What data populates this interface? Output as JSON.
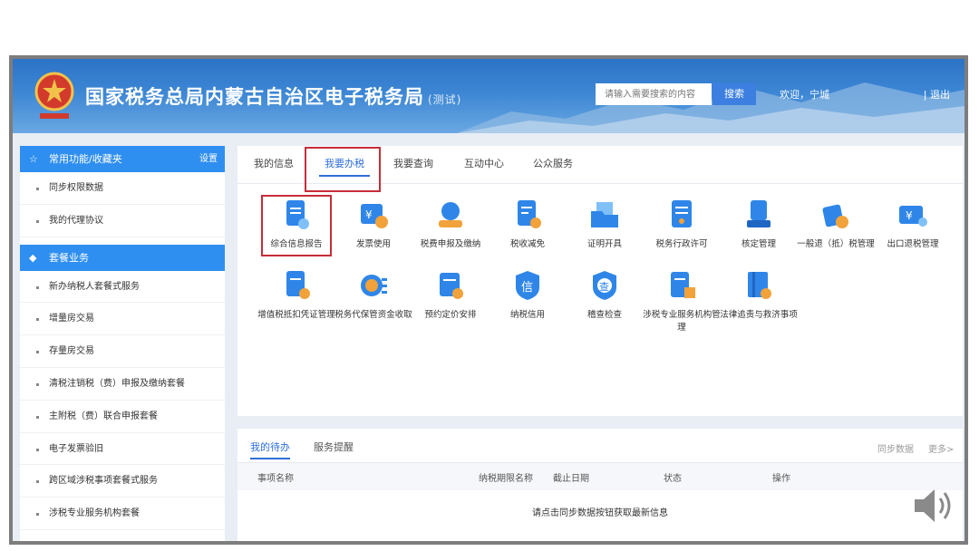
{
  "header": {
    "title": "国家税务总局内蒙古自治区电子税务局",
    "title_suffix": "(测试)",
    "search_placeholder": "请输入需要搜索的内容",
    "search_button": "搜索",
    "welcome": "欢迎，宁城",
    "logout": "| 退出"
  },
  "sidebar": {
    "section1": {
      "title": "常用功能/收藏夹",
      "action": "设置"
    },
    "section1_items": [
      "同步权限数据",
      "我的代理协议"
    ],
    "section2": {
      "title": "套餐业务"
    },
    "section2_items": [
      "新办纳税人套餐式服务",
      "增量房交易",
      "存量房交易",
      "清税注销税（费）申报及缴纳套餐",
      "主附税（费）联合申报套餐",
      "电子发票验旧",
      "跨区域涉税事项套餐式服务",
      "涉税专业服务机构套餐"
    ]
  },
  "tabs": [
    "我的信息",
    "我要办税",
    "我要查询",
    "互动中心",
    "公众服务"
  ],
  "services_row1": [
    {
      "label": "综合信息报告",
      "icon": "document-report-icon"
    },
    {
      "label": "发票使用",
      "icon": "invoice-icon"
    },
    {
      "label": "税费申报及缴纳",
      "icon": "tax-payment-icon"
    },
    {
      "label": "税收减免",
      "icon": "tax-relief-icon"
    },
    {
      "label": "证明开具",
      "icon": "certificate-folder-icon"
    },
    {
      "label": "税务行政许可",
      "icon": "permit-icon"
    },
    {
      "label": "核定管理",
      "icon": "approval-icon"
    },
    {
      "label": "一般退（抵）税管理",
      "icon": "refund-card-icon"
    },
    {
      "label": "出口退税管理",
      "icon": "export-refund-icon"
    }
  ],
  "services_row2": [
    {
      "label": "增值税抵扣凭证管理",
      "icon": "vat-deduction-icon"
    },
    {
      "label": "税务代保管资金收取",
      "icon": "custody-funds-icon"
    },
    {
      "label": "预约定价安排",
      "icon": "pricing-arrangement-icon"
    },
    {
      "label": "纳税信用",
      "icon": "credit-icon"
    },
    {
      "label": "稽查检查",
      "icon": "inspection-shield-icon"
    },
    {
      "label": "涉税专业服务机构管理",
      "icon": "agency-management-icon"
    },
    {
      "label": "法律追责与救济事项",
      "icon": "legal-book-icon"
    }
  ],
  "services_row2_glyph": {
    "credit": "信",
    "inspection": "查"
  },
  "todo": {
    "tabs": [
      "我的待办",
      "服务提醒"
    ],
    "sync_link": "同步数据",
    "more_link": "更多>",
    "columns": [
      "事项名称",
      "纳税期限名称",
      "截止日期",
      "状态",
      "操作"
    ],
    "empty_message": "请点击同步数据按钮获取最新信息"
  },
  "colors": {
    "accent": "#2f8ff0",
    "highlight_border": "#c62d3a",
    "icon_blue": "#2f86e8",
    "icon_orange": "#f2a23a"
  }
}
